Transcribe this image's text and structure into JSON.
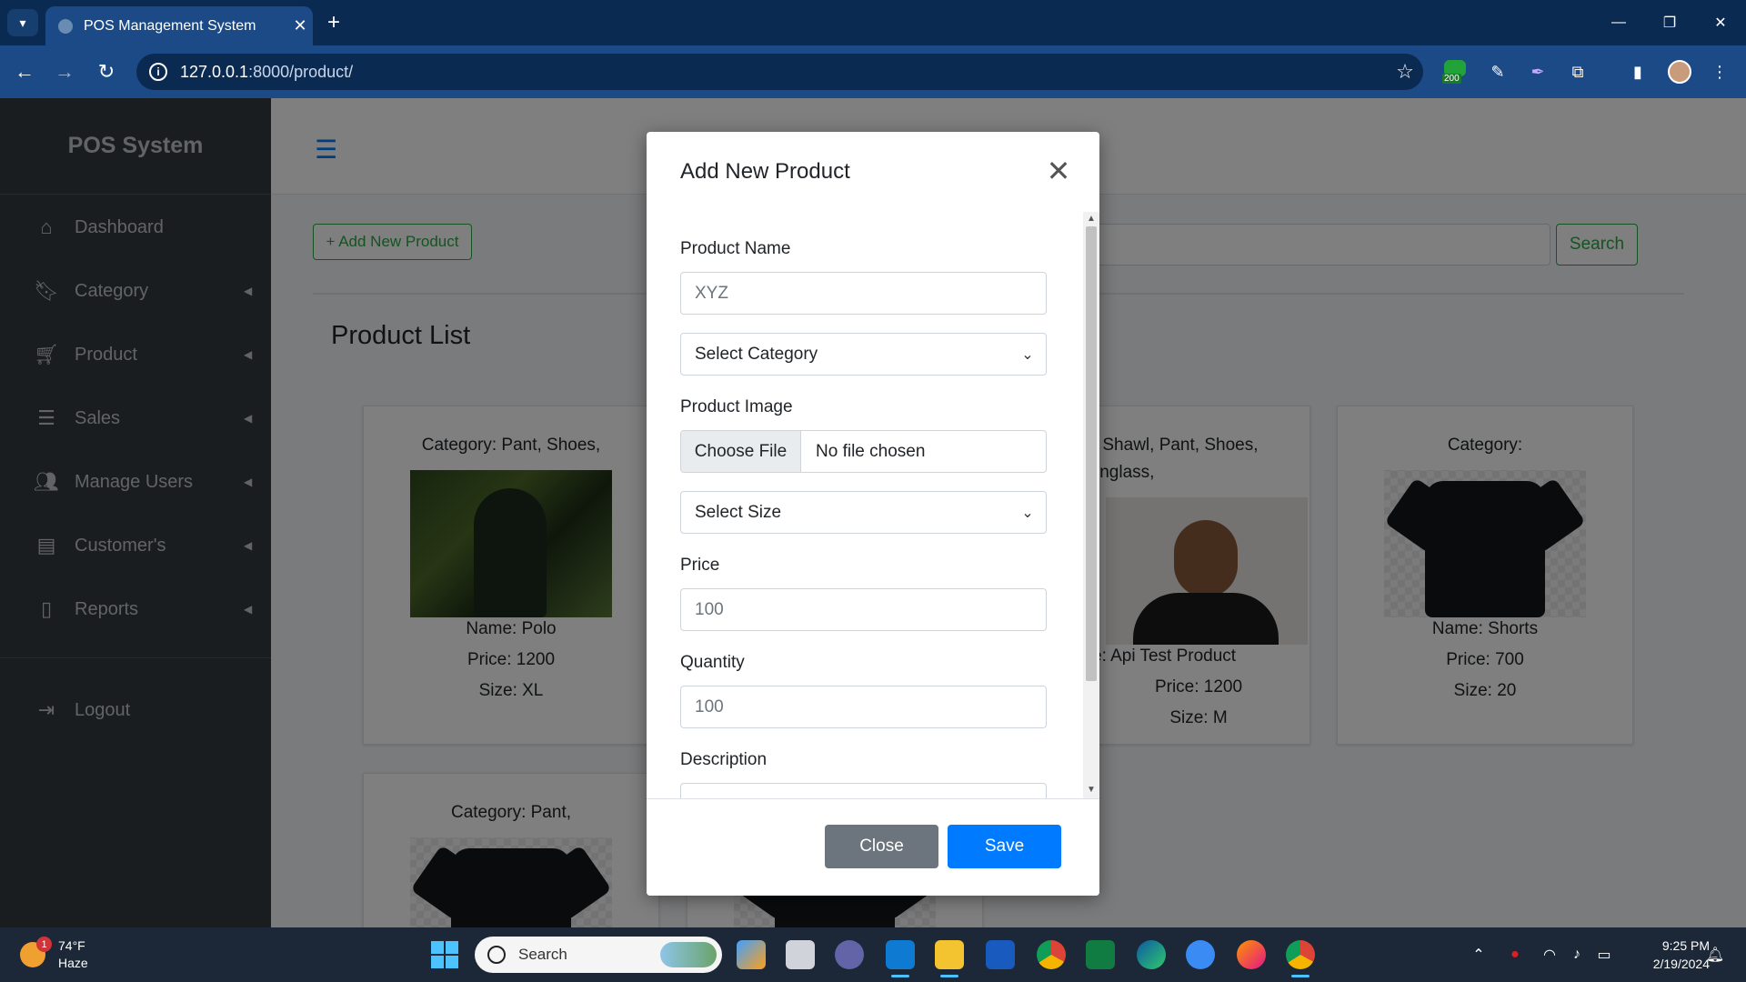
{
  "browser": {
    "tab_title": "POS Management System",
    "url_host": "127.0.0.1",
    "url_rest": ":8000/product/",
    "ext_badge": "200"
  },
  "sidebar": {
    "brand": "POS System",
    "items": [
      {
        "label": "Dashboard",
        "icon": "home-icon",
        "caret": false
      },
      {
        "label": "Category",
        "icon": "bookmark-icon",
        "caret": true
      },
      {
        "label": "Product",
        "icon": "cart-icon",
        "caret": true
      },
      {
        "label": "Sales",
        "icon": "list-icon",
        "caret": true
      },
      {
        "label": "Manage Users",
        "icon": "users-icon",
        "caret": true
      },
      {
        "label": "Customer's",
        "icon": "id-card-icon",
        "caret": true
      },
      {
        "label": "Reports",
        "icon": "file-icon",
        "caret": true
      }
    ],
    "logout": "Logout"
  },
  "main": {
    "add_button": "+ Add New Product",
    "search_button": "Search",
    "list_title": "Product List",
    "cards": [
      {
        "category": "Category: Pant, Shoes,",
        "name": "Name: Polo",
        "price": "Price: 1200",
        "size": "Size: XL"
      },
      {
        "category": "ry: Shawl, Pant, Shoes, Sunglass,",
        "name": "e: Api Test Product",
        "price": "Price: 1200",
        "size": "Size: M"
      },
      {
        "category": "Category:",
        "name": "Name: Shorts",
        "price": "Price: 700",
        "size": "Size: 20"
      },
      {
        "category": "Category: Pant,"
      }
    ]
  },
  "modal": {
    "title": "Add New Product",
    "product_name_label": "Product Name",
    "product_name_placeholder": "XYZ",
    "category_select": "Select Category",
    "image_label": "Product Image",
    "choose_file": "Choose File",
    "no_file": "No file chosen",
    "size_select": "Select Size",
    "price_label": "Price",
    "price_placeholder": "100",
    "quantity_label": "Quantity",
    "quantity_placeholder": "100",
    "description_label": "Description",
    "close_button": "Close",
    "save_button": "Save"
  },
  "taskbar": {
    "temp": "74°F",
    "condition": "Haze",
    "notif_count": "1",
    "search": "Search",
    "time": "9:25 PM",
    "date": "2/19/2024"
  },
  "colors": {
    "primary": "#007bff",
    "success": "#28a745",
    "secondary": "#6c757d",
    "sidebar": "#343a40"
  }
}
